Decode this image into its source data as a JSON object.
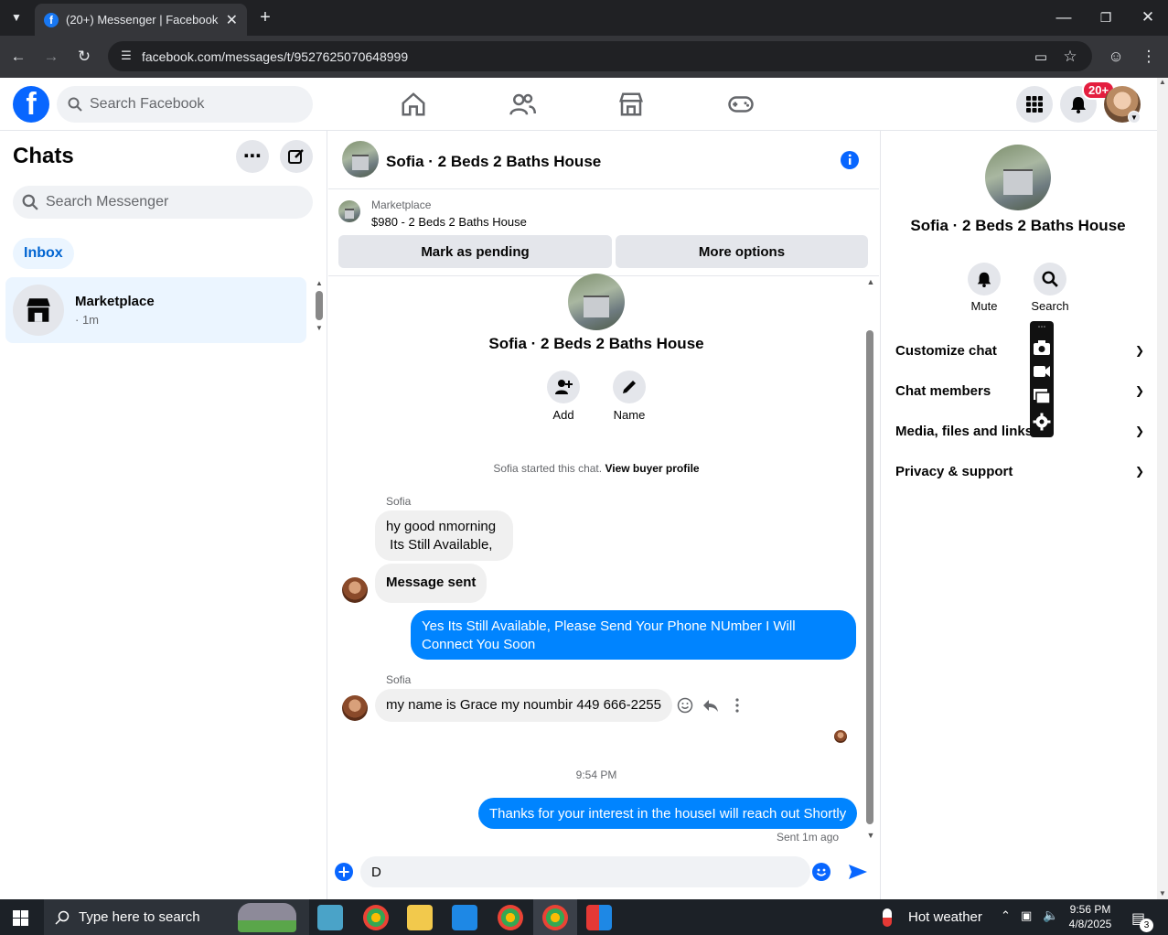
{
  "browser": {
    "tab_title": "(20+) Messenger | Facebook",
    "url": "facebook.com/messages/t/9527625070648999"
  },
  "fb": {
    "search_placeholder": "Search Facebook",
    "notif_badge": "20+"
  },
  "left": {
    "title": "Chats",
    "search_placeholder": "Search Messenger",
    "filter": "Inbox",
    "chats": [
      {
        "name": "Marketplace",
        "meta": "· 1m"
      }
    ]
  },
  "conversation": {
    "title": "Sofia · 2 Beds 2 Baths House",
    "marketplace_label": "Marketplace",
    "listing": "$980 - 2 Beds 2 Baths House",
    "mark_pending": "Mark as pending",
    "more_options": "More options",
    "intro_name": "Sofia · 2 Beds 2 Baths House",
    "add_label": "Add",
    "name_label": "Name",
    "started_text": "Sofia started this chat.",
    "buyer_profile": "View buyer profile",
    "messages": [
      {
        "sender": "Sofia",
        "text_line1": "hy good nmorning",
        "text_line2": " Its Still Available,"
      },
      {
        "text": "Message sent"
      },
      {
        "text": "Yes Its Still Available, Please Send Your Phone NUmber I Will Connect You Soon"
      },
      {
        "sender": "Sofia",
        "text": "my name is Grace my noumbir 449 666-2255"
      },
      {
        "timestamp": "9:54 PM"
      },
      {
        "text": "Thanks for your interest in the houseI will reach out Shortly"
      }
    ],
    "sent_status": "Sent 1m ago",
    "composer_value": "D"
  },
  "right": {
    "title": "Sofia · 2 Beds 2 Baths House",
    "mute": "Mute",
    "search": "Search",
    "sections": [
      "Customize chat",
      "Chat members",
      "Media, files and links",
      "Privacy & support"
    ]
  },
  "taskbar": {
    "search_placeholder": "Type here to search",
    "weather": "Hot weather",
    "time": "9:56 PM",
    "date": "4/8/2025",
    "notif_count": "3"
  }
}
